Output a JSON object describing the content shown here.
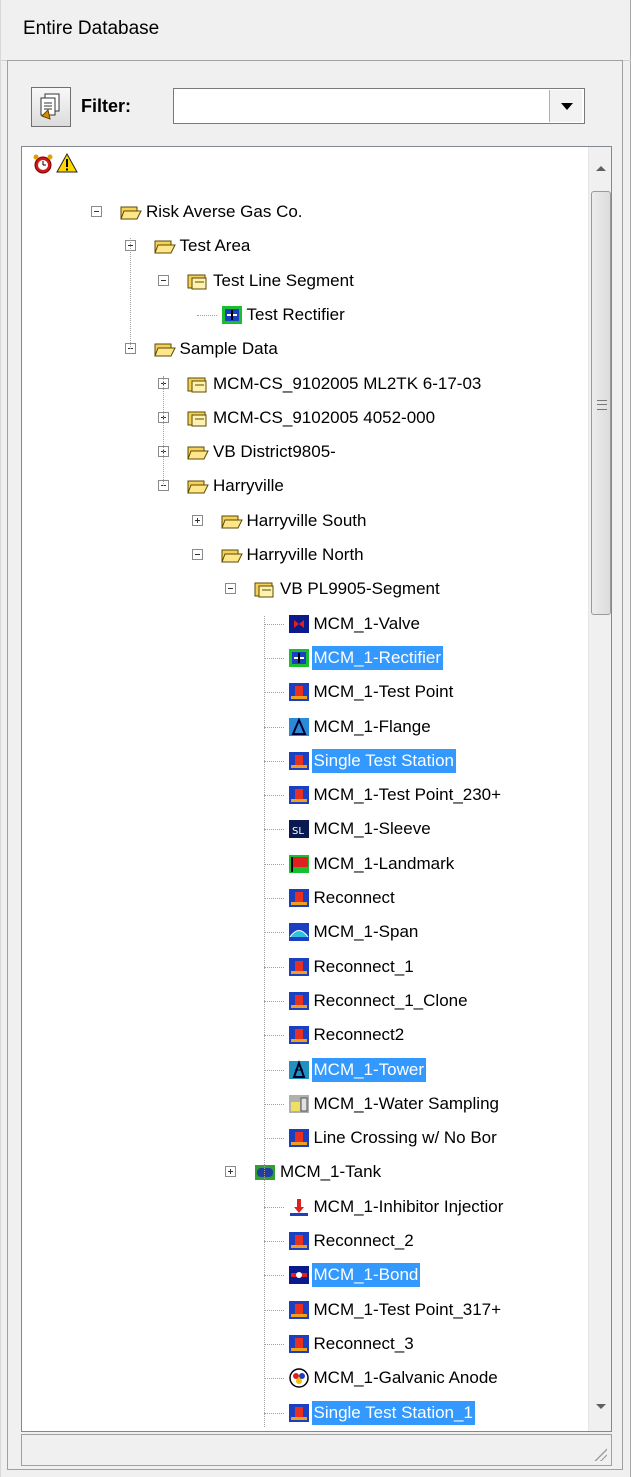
{
  "window": {
    "title": "Entire Database"
  },
  "filter": {
    "label": "Filter:",
    "value": ""
  },
  "tree": {
    "nodes": [
      {
        "label": "Risk Averse Gas Co.",
        "icon": "folder-open-icon",
        "expander": "minus",
        "selected": false
      },
      {
        "label": "Test Area",
        "icon": "folder-open-icon",
        "expander": "minus",
        "selected": false
      },
      {
        "label": "Test Line Segment",
        "icon": "segment-folder-icon",
        "expander": "minus",
        "selected": false
      },
      {
        "label": "Test Rectifier",
        "icon": "rectifier-icon",
        "expander": "",
        "selected": false
      },
      {
        "label": "Sample Data",
        "icon": "folder-open-icon",
        "expander": "minus",
        "selected": false
      },
      {
        "label": "MCM-CS_9102005 ML2TK 6-17-03",
        "icon": "segment-folder-icon",
        "expander": "plus",
        "selected": false
      },
      {
        "label": "MCM-CS_9102005 4052-000",
        "icon": "segment-folder-icon",
        "expander": "plus",
        "selected": false
      },
      {
        "label": "VB District9805-",
        "icon": "folder-open-icon",
        "expander": "plus",
        "selected": false
      },
      {
        "label": "Harryville",
        "icon": "folder-open-icon",
        "expander": "minus",
        "selected": false
      },
      {
        "label": "Harryville South",
        "icon": "folder-open-icon",
        "expander": "plus",
        "selected": false
      },
      {
        "label": "Harryville North",
        "icon": "folder-open-icon",
        "expander": "minus",
        "selected": false
      },
      {
        "label": "VB PL9905-Segment",
        "icon": "segment-folder-icon",
        "expander": "minus",
        "selected": false
      },
      {
        "label": "MCM_1-Valve",
        "icon": "valve-icon",
        "expander": "",
        "selected": false
      },
      {
        "label": "MCM_1-Rectifier",
        "icon": "rectifier-icon",
        "expander": "",
        "selected": true
      },
      {
        "label": "MCM_1-Test Point",
        "icon": "test-point-icon",
        "expander": "",
        "selected": false
      },
      {
        "label": "MCM_1-Flange",
        "icon": "flange-icon",
        "expander": "",
        "selected": false
      },
      {
        "label": "Single Test Station",
        "icon": "test-point-icon",
        "expander": "",
        "selected": true
      },
      {
        "label": "MCM_1-Test Point_230+",
        "icon": "test-point-icon",
        "expander": "",
        "selected": false
      },
      {
        "label": "MCM_1-Sleeve",
        "icon": "sleeve-icon",
        "expander": "",
        "selected": false
      },
      {
        "label": "MCM_1-Landmark",
        "icon": "landmark-icon",
        "expander": "",
        "selected": false
      },
      {
        "label": "Reconnect",
        "icon": "test-point-icon",
        "expander": "",
        "selected": false
      },
      {
        "label": "MCM_1-Span",
        "icon": "span-icon",
        "expander": "",
        "selected": false
      },
      {
        "label": "Reconnect_1",
        "icon": "test-point-icon",
        "expander": "",
        "selected": false
      },
      {
        "label": "Reconnect_1_Clone",
        "icon": "test-point-icon",
        "expander": "",
        "selected": false
      },
      {
        "label": "Reconnect2",
        "icon": "test-point-icon",
        "expander": "",
        "selected": false
      },
      {
        "label": "MCM_1-Tower",
        "icon": "tower-icon",
        "expander": "",
        "selected": true
      },
      {
        "label": "MCM_1-Water Sampling",
        "icon": "water-sampling-icon",
        "expander": "",
        "selected": false
      },
      {
        "label": "Line Crossing w/ No Bor",
        "icon": "test-point-icon",
        "expander": "",
        "selected": false
      },
      {
        "label": "MCM_1-Tank",
        "icon": "tank-icon",
        "expander": "plus",
        "selected": false
      },
      {
        "label": "MCM_1-Inhibitor Injectior",
        "icon": "inhibitor-icon",
        "expander": "",
        "selected": false
      },
      {
        "label": "Reconnect_2",
        "icon": "test-point-icon",
        "expander": "",
        "selected": false
      },
      {
        "label": "MCM_1-Bond",
        "icon": "bond-icon",
        "expander": "",
        "selected": true
      },
      {
        "label": "MCM_1-Test Point_317+",
        "icon": "test-point-icon",
        "expander": "",
        "selected": false
      },
      {
        "label": "Reconnect_3",
        "icon": "test-point-icon",
        "expander": "",
        "selected": false
      },
      {
        "label": "MCM_1-Galvanic Anode",
        "icon": "anode-icon",
        "expander": "",
        "selected": false
      },
      {
        "label": "Single Test Station_1",
        "icon": "test-point-icon",
        "expander": "",
        "selected": true
      }
    ]
  }
}
